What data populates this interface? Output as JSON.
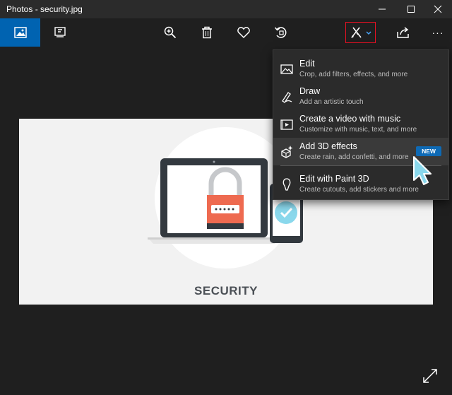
{
  "window": {
    "title": "Photos - security.jpg",
    "controls": [
      "minimize-icon",
      "maximize-icon",
      "close-icon"
    ]
  },
  "toolbar": {
    "left": [
      "photos-home-icon",
      "slideshow-icon"
    ],
    "center": [
      "zoom-in-icon",
      "delete-icon",
      "favorite-icon",
      "rotate-icon"
    ],
    "right": [
      "edit-create-icon",
      "share-icon",
      "more-icon"
    ],
    "more_label": "···"
  },
  "photo": {
    "caption": "SECURITY",
    "accent_orange": "#ee6a50",
    "accent_teal": "#8ad8ec"
  },
  "edit_menu": {
    "items": [
      {
        "title": "Edit",
        "subtitle": "Crop, add filters, effects, and more",
        "icon": "photo-edit-icon"
      },
      {
        "title": "Draw",
        "subtitle": "Add an artistic touch",
        "icon": "pen-icon"
      },
      {
        "title": "Create a video with music",
        "subtitle": "Customize with music, text, and more",
        "icon": "video-icon"
      },
      {
        "title": "Add 3D effects",
        "subtitle": "Create rain, add confetti, and more",
        "icon": "3d-effects-icon",
        "badge": "NEW",
        "highlighted": true
      },
      {
        "title": "Edit with Paint 3D",
        "subtitle": "Create cutouts, add stickers and more",
        "icon": "paint3d-icon"
      }
    ],
    "badge_color": "#0e6ab5"
  }
}
